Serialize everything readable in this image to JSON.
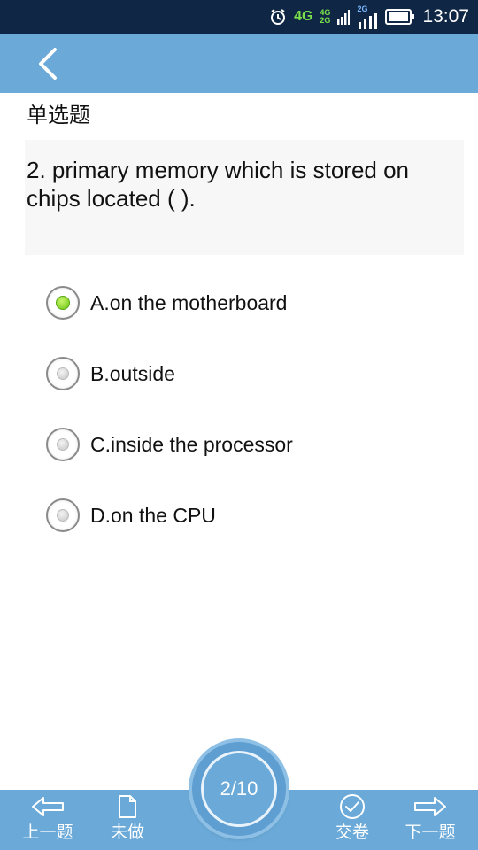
{
  "status_bar": {
    "network_main": "4G",
    "network_top": "4G",
    "network_bottom": "2G",
    "network_secondary": "2G",
    "time": "13:07",
    "icons": [
      "alarm-icon",
      "signal-icon",
      "battery-icon"
    ]
  },
  "header": {
    "back_icon": "chevron-left-icon"
  },
  "question": {
    "type": "单选题",
    "text": "2. primary memory which is stored on chips located ( ).",
    "options": [
      {
        "label": "A.on the motherboard",
        "selected": true
      },
      {
        "label": "B.outside",
        "selected": false
      },
      {
        "label": "C.inside the processor",
        "selected": false
      },
      {
        "label": "D.on the CPU",
        "selected": false
      }
    ]
  },
  "bottom_bar": {
    "prev_label": "上一题",
    "unanswered_label": "未做",
    "page_indicator": "2/10",
    "submit_label": "交卷",
    "next_label": "下一题"
  },
  "colors": {
    "header": "#6aa9d8",
    "status_bar": "#0f2744",
    "selected_radio": "#69c514"
  }
}
